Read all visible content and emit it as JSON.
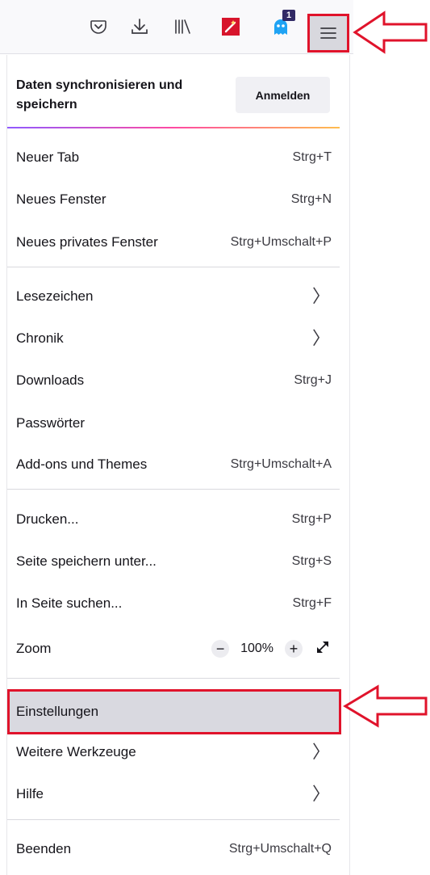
{
  "toolbar": {
    "icons": [
      "pocket-icon",
      "download-icon",
      "library-icon",
      "extension-red-icon",
      "extension-ghost-icon"
    ],
    "extension_badge": "1",
    "menu_icon": "hamburger-menu-icon"
  },
  "sync": {
    "label": "Daten synchronisieren und speichern",
    "login_button": "Anmelden"
  },
  "menu": {
    "new_tab": {
      "label": "Neuer Tab",
      "shortcut": "Strg+T"
    },
    "new_window": {
      "label": "Neues Fenster",
      "shortcut": "Strg+N"
    },
    "new_private": {
      "label": "Neues privates Fenster",
      "shortcut": "Strg+Umschalt+P"
    },
    "bookmarks": {
      "label": "Lesezeichen"
    },
    "history": {
      "label": "Chronik"
    },
    "downloads": {
      "label": "Downloads",
      "shortcut": "Strg+J"
    },
    "passwords": {
      "label": "Passwörter"
    },
    "addons": {
      "label": "Add-ons und Themes",
      "shortcut": "Strg+Umschalt+A"
    },
    "print": {
      "label": "Drucken...",
      "shortcut": "Strg+P"
    },
    "save_page": {
      "label": "Seite speichern unter...",
      "shortcut": "Strg+S"
    },
    "find": {
      "label": "In Seite suchen...",
      "shortcut": "Strg+F"
    },
    "zoom": {
      "label": "Zoom",
      "minus": "−",
      "value": "100%",
      "plus": "+"
    },
    "settings": {
      "label": "Einstellungen"
    },
    "more_tools": {
      "label": "Weitere Werkzeuge"
    },
    "help": {
      "label": "Hilfe"
    },
    "quit": {
      "label": "Beenden",
      "shortcut": "Strg+Umschalt+Q"
    }
  },
  "colors": {
    "highlight_red": "#e0132b",
    "hover_gray": "#d9d9e0"
  }
}
